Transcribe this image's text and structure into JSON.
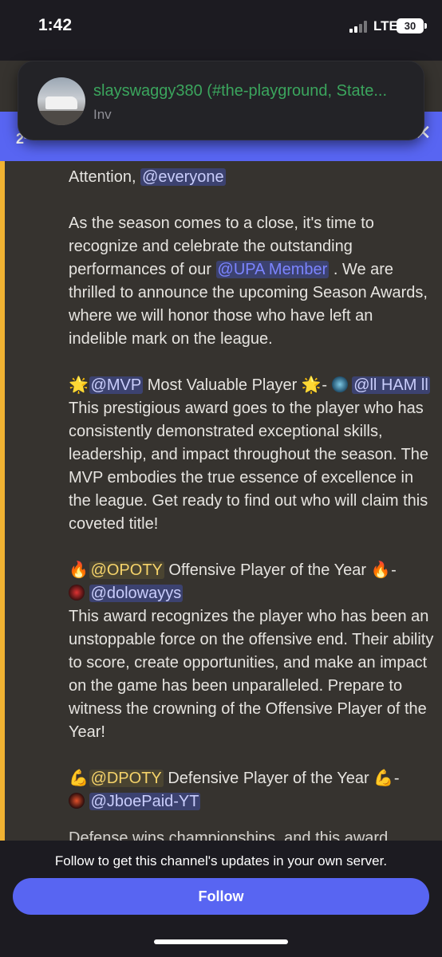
{
  "status_bar": {
    "time": "1:42",
    "network": "LTE",
    "battery": "30"
  },
  "notification": {
    "title": "slayswaggy380 (#the-playground, State...",
    "subtitle": "Inv"
  },
  "header": {
    "left_text": "2"
  },
  "message": {
    "p1": {
      "prefix": "Attention, ",
      "mention": "@everyone"
    },
    "p2": {
      "text_a": "As the season comes to a close, it's time to recognize and celebrate the outstanding performances of our ",
      "mention": "@UPA Member",
      "text_b": " . We are thrilled to announce the upcoming Season Awards, where we will honor those who have left an indelible mark on the league."
    },
    "mvp": {
      "emoji": "🌟",
      "role": "@MVP",
      "title": " Most Valuable Player ",
      "dash": " - ",
      "user": "@ll HAM ll",
      "body": "This prestigious award goes to the player who has consistently demonstrated exceptional skills, leadership, and impact throughout the season. The MVP embodies the true essence of excellence in the league. Get ready to find out who will claim this coveted title!"
    },
    "opoty": {
      "emoji": "🔥",
      "role": "@OPOTY",
      "title": " Offensive Player of the Year ",
      "dash": " - ",
      "user": "@dolowayys",
      "body": "This award recognizes the player who has been an unstoppable force on the offensive end. Their ability to score, create opportunities, and make an impact on the game has been unparalleled. Prepare to witness the crowning of the Offensive Player of the Year!"
    },
    "dpoty": {
      "emoji": "💪",
      "role": "@DPOTY",
      "title": " Defensive Player of the Year ",
      "dash": " - ",
      "user": "@JboePaid-YT"
    },
    "cutoff": "Defense wins championships, and this award"
  },
  "footer": {
    "text": "Follow to get this channel's updates in your own server.",
    "button": "Follow"
  }
}
